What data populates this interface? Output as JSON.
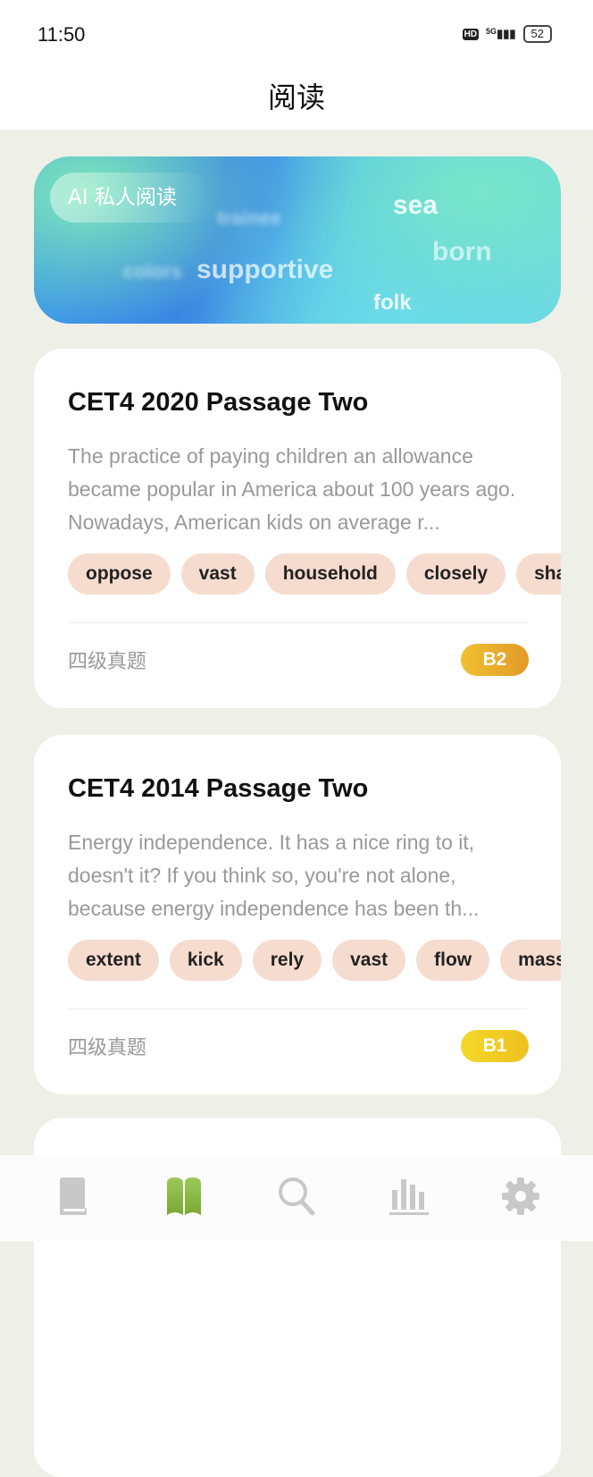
{
  "status_bar": {
    "time": "11:50",
    "hd": "HD",
    "network": "5G",
    "battery": "52"
  },
  "header": {
    "title": "阅读"
  },
  "banner": {
    "label": "AI 私人阅读",
    "words": [
      "sea",
      "born",
      "supportive",
      "folk",
      "trainee",
      "colors"
    ]
  },
  "cards": [
    {
      "title": "CET4 2020 Passage Two",
      "description": "The practice of paying children an allowance became popular in America about 100 years ago. Nowadays, American kids on average r...",
      "tags": [
        "oppose",
        "vast",
        "household",
        "closely",
        "shallow"
      ],
      "category": "四级真题",
      "level": "B2",
      "level_color": "#e8a82a"
    },
    {
      "title": "CET4 2014 Passage Two",
      "description": "Energy independence. It has a nice ring to it, doesn't it? If you think so, you're not alone, because energy independence has been th...",
      "tags": [
        "extent",
        "kick",
        "rely",
        "vast",
        "flow",
        "massive"
      ],
      "category": "四级真题",
      "level": "B1",
      "level_color": "#f0c824"
    }
  ],
  "bottom_nav": {
    "items": [
      {
        "icon": "book-icon",
        "active": false
      },
      {
        "icon": "open-book-icon",
        "active": true
      },
      {
        "icon": "search-icon",
        "active": false
      },
      {
        "icon": "bar-chart-icon",
        "active": false
      },
      {
        "icon": "gear-icon",
        "active": false
      }
    ],
    "active_color": "#8ab83a",
    "inactive_color": "#c8c8c8"
  }
}
